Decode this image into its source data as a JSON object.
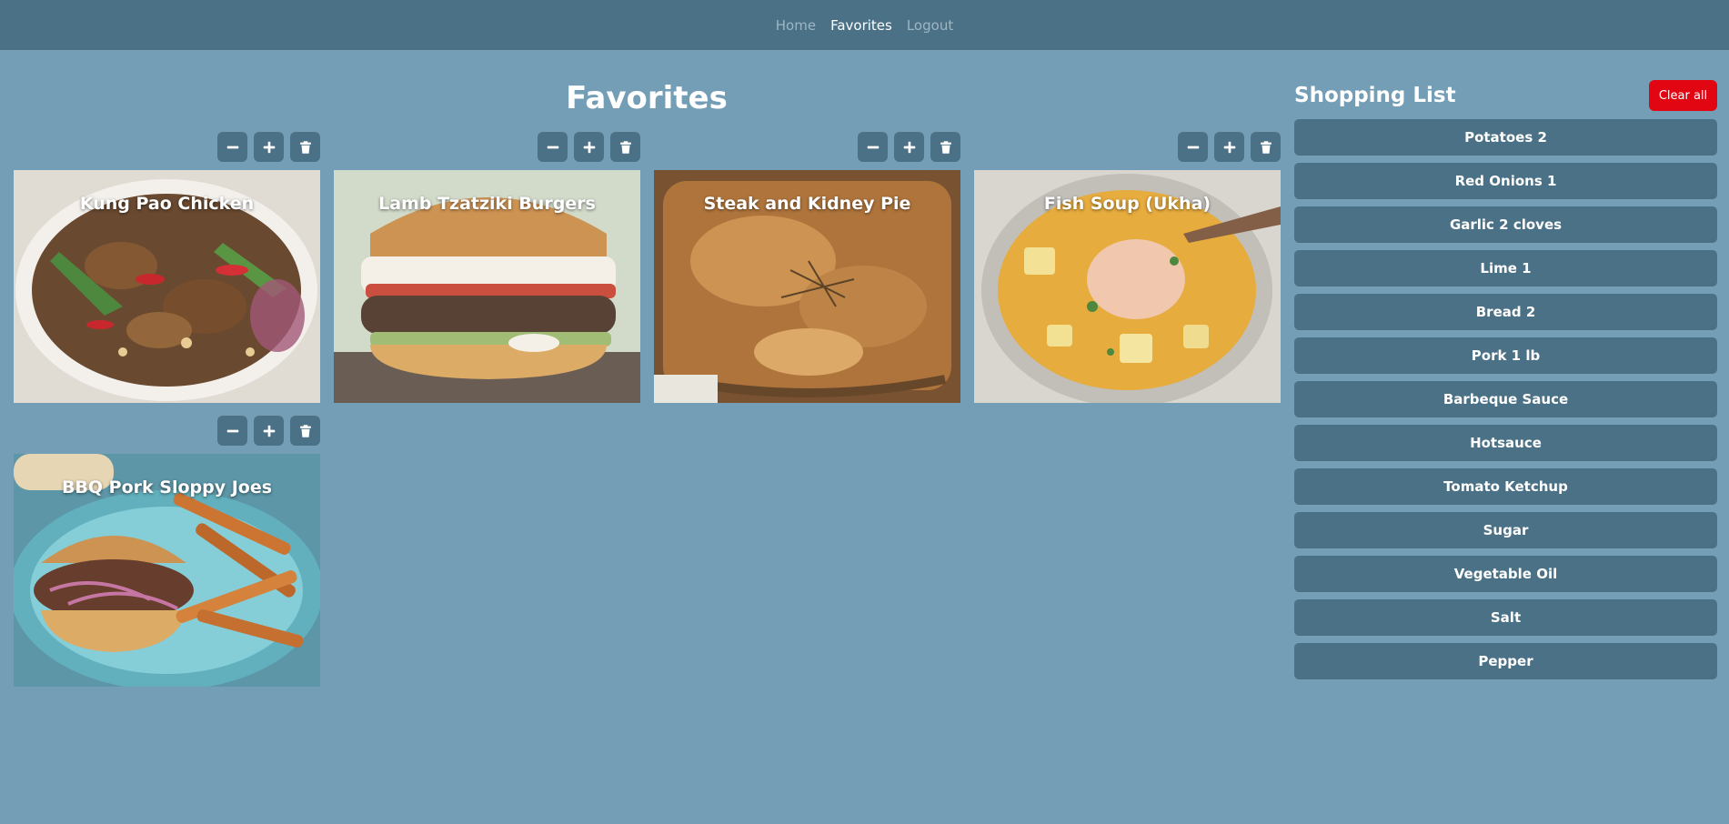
{
  "nav": {
    "home": "Home",
    "favorites": "Favorites",
    "logout": "Logout"
  },
  "page": {
    "title": "Favorites"
  },
  "recipes": [
    {
      "title": "Kung Pao Chicken"
    },
    {
      "title": "Lamb Tzatziki Burgers"
    },
    {
      "title": "Steak and Kidney Pie"
    },
    {
      "title": "Fish Soup (Ukha)"
    },
    {
      "title": "BBQ Pork Sloppy Joes"
    }
  ],
  "icons": {
    "decrease": "minus-icon",
    "increase": "plus-icon",
    "delete": "trash-icon"
  },
  "shopping": {
    "title": "Shopping List",
    "clear_label": "Clear all",
    "items": [
      {
        "label": "Potatoes 2"
      },
      {
        "label": "Red Onions 1"
      },
      {
        "label": "Garlic 2 cloves"
      },
      {
        "label": "Lime 1"
      },
      {
        "label": "Bread 2"
      },
      {
        "label": "Pork 1 lb"
      },
      {
        "label": "Barbeque Sauce"
      },
      {
        "label": "Hotsauce"
      },
      {
        "label": "Tomato Ketchup"
      },
      {
        "label": "Sugar"
      },
      {
        "label": "Vegetable Oil"
      },
      {
        "label": "Salt"
      },
      {
        "label": "Pepper"
      }
    ]
  },
  "colors": {
    "background": "#739eb6",
    "navbar": "#4b7186",
    "button": "#4b7186",
    "clear_button": "#e20613",
    "text": "#ffffff"
  }
}
